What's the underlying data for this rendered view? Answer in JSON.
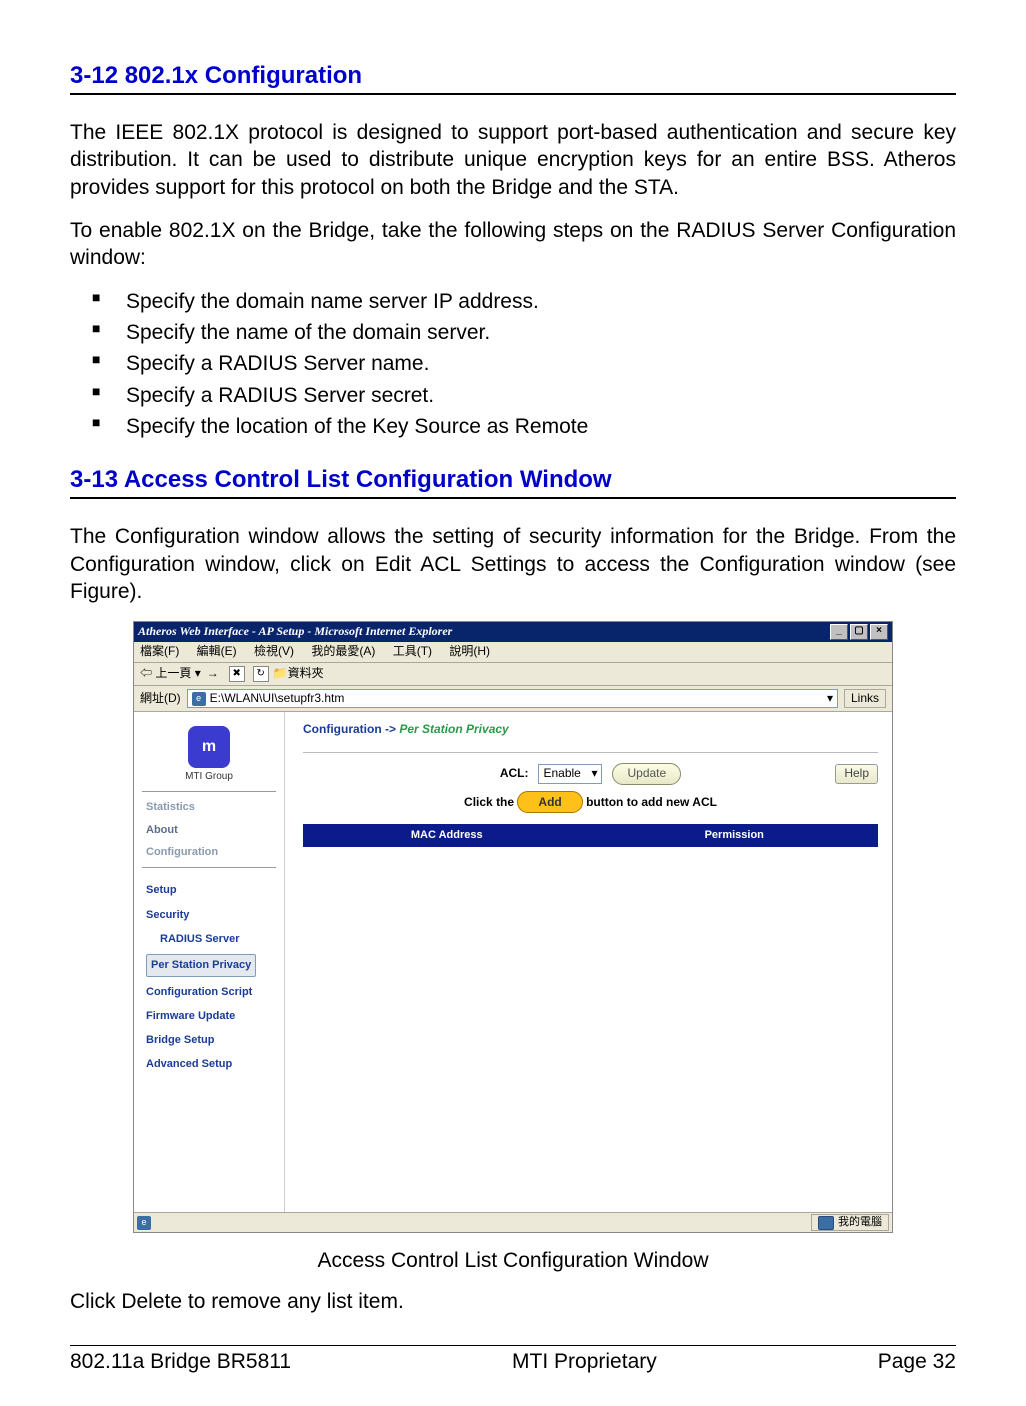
{
  "headings": {
    "h1": "3-12 802.1x Configuration",
    "h2": "3-13 Access Control List Configuration Window"
  },
  "paragraphs": {
    "p1": "The IEEE 802.1X protocol is designed to support port-based authentication and secure key distribution. It can be used to distribute unique encryption keys for an entire BSS. Atheros provides support for this protocol on both the Bridge and the STA.",
    "p2": "To enable 802.1X on the Bridge, take the following steps on the RADIUS Server Configuration window:",
    "p3": "The Configuration window allows the setting of security information for the Bridge. From the Configuration window, click on Edit ACL Settings to access the Configuration window (see Figure)."
  },
  "bullets": [
    "Specify the domain name server IP address.",
    "Specify the name of the domain server.",
    "Specify a RADIUS Server name.",
    "Specify a RADIUS Server secret.",
    "Specify the location of the Key Source as Remote"
  ],
  "ie": {
    "title": "Atheros Web Interface - AP Setup - Microsoft Internet Explorer",
    "menu": {
      "file": "檔案(F)",
      "edit": "編輯(E)",
      "view": "檢視(V)",
      "fav": "我的最愛(A)",
      "tools": "工具(T)",
      "help": "說明(H)"
    },
    "toolbar": {
      "back": "上一頁",
      "bookmarks": "資料夾"
    },
    "address": {
      "label": "網址(D)",
      "url": "E:\\WLAN\\UI\\setupfr3.htm",
      "links": "Links"
    },
    "status": {
      "mypc": "我的電腦"
    }
  },
  "app": {
    "logo": "MTI Group",
    "nav": {
      "stats": "Statistics",
      "about": "About",
      "config": "Configuration"
    },
    "subnav": {
      "setup": "Setup",
      "security": "Security",
      "radius": "RADIUS Server",
      "per_station": "Per Station Privacy",
      "config_script": "Configuration Script",
      "firmware": "Firmware Update",
      "bridge_setup": "Bridge Setup",
      "advanced": "Advanced Setup"
    },
    "breadcrumb": {
      "a": "Configuration",
      "sep": " -> ",
      "b": "Per Station Privacy"
    },
    "acl": {
      "label": "ACL:",
      "value": "Enable",
      "update": "Update",
      "help": "Help"
    },
    "add": {
      "pre": "Click the ",
      "btn": "Add",
      "post": " button to add new ACL"
    },
    "table": {
      "h1": "MAC Address",
      "h2": "Permission"
    }
  },
  "caption": "Access Control List Configuration Window",
  "closing": "Click Delete to remove any list item.",
  "footer": {
    "left": "802.11a Bridge BR5811",
    "center": "MTI Proprietary",
    "right": "Page 32"
  }
}
